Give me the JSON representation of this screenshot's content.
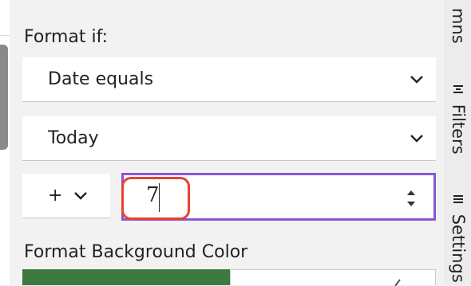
{
  "panel": {
    "format_if_label": "Format if:",
    "condition_select": {
      "value": "Date equals"
    },
    "date_select": {
      "value": "Today"
    },
    "operator_select": {
      "value": "+"
    },
    "number_input": {
      "value": "7"
    },
    "background_color_label": "Format Background Color",
    "background_color": "#3d7a3f"
  },
  "right_rail": {
    "tabs": [
      {
        "label": "mns",
        "icon": ""
      },
      {
        "label": "Filters",
        "icon": "filter-icon"
      },
      {
        "label": "Settings",
        "icon": "settings-icon"
      }
    ]
  },
  "colors": {
    "accent": "#8a55d6",
    "annotation": "#e8412f"
  }
}
